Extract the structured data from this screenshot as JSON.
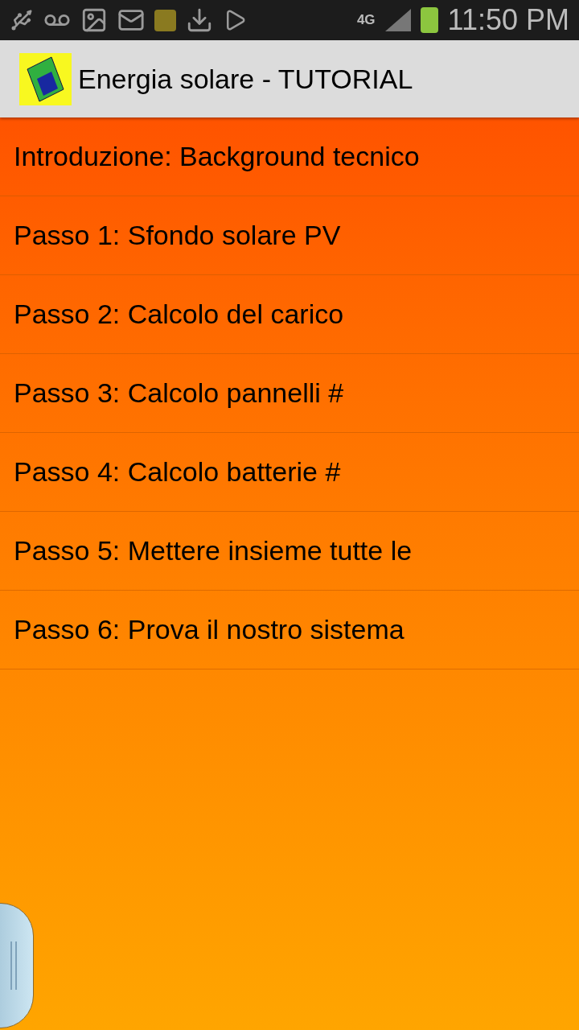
{
  "status_bar": {
    "network": "4G",
    "time": "11:50 PM"
  },
  "app_bar": {
    "title": "Energia solare - TUTORIAL"
  },
  "items": [
    {
      "label": "Introduzione: Background tecnico"
    },
    {
      "label": "Passo 1: Sfondo solare PV"
    },
    {
      "label": "Passo 2: Calcolo del carico"
    },
    {
      "label": "Passo 3: Calcolo pannelli #"
    },
    {
      "label": "Passo 4: Calcolo batterie #"
    },
    {
      "label": "Passo 5: Mettere insieme tutte le"
    },
    {
      "label": "Passo 6: Prova il nostro sistema"
    }
  ]
}
